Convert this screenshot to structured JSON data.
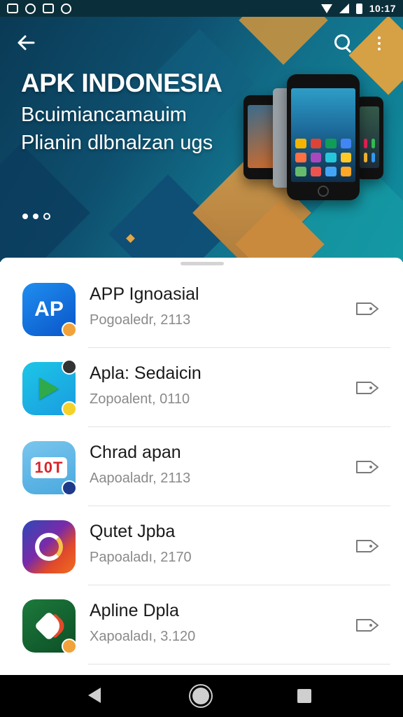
{
  "status_bar": {
    "time": "10:17",
    "left_icons": [
      "gallery-icon",
      "clock-icon",
      "photo-icon",
      "lock-icon"
    ],
    "right_icons": [
      "wifi-icon",
      "signal-icon",
      "battery-icon"
    ]
  },
  "header": {
    "back_icon": "arrow-left-icon",
    "search_icon": "search-icon",
    "more_icon": "more-vertical-icon"
  },
  "banner": {
    "title": "APK INDONESIA",
    "subtitle_line1": "Bcuimiancamauim",
    "subtitle_line2": "Plianin dlbnalzan ugs",
    "page_indicator": {
      "count": 3,
      "active": 2
    }
  },
  "apps": [
    {
      "name": "APP Ignoasial",
      "meta": "Pogoaledr, 2113",
      "icon": "ap-app-icon",
      "icon_text": "AP",
      "action_icon": "tag-icon"
    },
    {
      "name": "Apla: Sedaicin",
      "meta": "Zopoalent, 0110",
      "icon": "play-app-icon",
      "action_icon": "tag-icon"
    },
    {
      "name": "Chrad apan",
      "meta": "Aapoaladr, 2113",
      "icon": "game-app-icon",
      "icon_text": "10T",
      "action_icon": "tag-icon"
    },
    {
      "name": "Qutet Jpba",
      "meta": "Papoaladı, 2170",
      "icon": "ring-app-icon",
      "action_icon": "tag-icon"
    },
    {
      "name": "Apline Dpla",
      "meta": "Xapoaladı, 3.120",
      "icon": "rocket-app-icon",
      "action_icon": "tag-icon"
    }
  ],
  "nav_bar": {
    "back_icon": "nav-back-icon",
    "home_icon": "nav-home-icon",
    "recents_icon": "nav-recents-icon"
  },
  "colors": {
    "banner_dark": "#0a3a55",
    "banner_teal": "#0f8fa0",
    "accent_orange": "#d49a4a",
    "text_primary": "#1a1a1a",
    "text_secondary": "#8a8a8a"
  }
}
